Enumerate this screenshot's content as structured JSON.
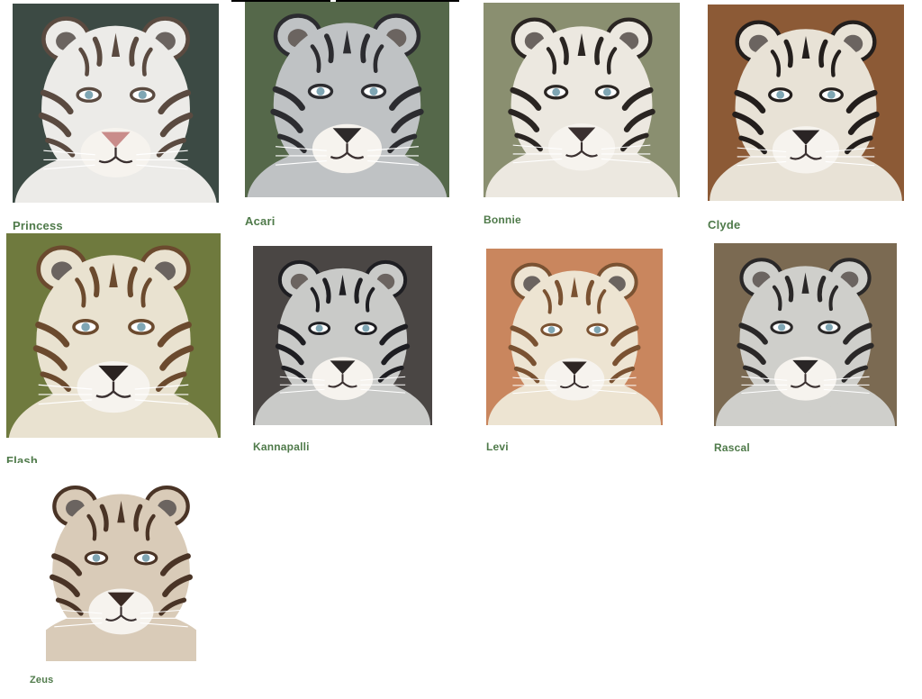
{
  "tigers": {
    "princess": {
      "name": "Princess",
      "colors": {
        "bg": "#3c4a44",
        "fur": "#ecebe8",
        "stripe": "#5a4a40",
        "nose": "#c98c8a"
      }
    },
    "acari": {
      "name": "Acari",
      "colors": {
        "bg": "#55684a",
        "fur": "#bfc2c4",
        "stripe": "#2c2c30",
        "nose": "#2d2a2a"
      }
    },
    "bonnie": {
      "name": "Bonnie",
      "colors": {
        "bg": "#8a8f70",
        "fur": "#ece8e0",
        "stripe": "#2a2522",
        "nose": "#3a3030"
      }
    },
    "clyde": {
      "name": "Clyde",
      "colors": {
        "bg": "#8c5a36",
        "fur": "#e8e2d6",
        "stripe": "#231e1c",
        "nose": "#2a2424"
      }
    },
    "flash": {
      "name": "Flash",
      "colors": {
        "bg": "#6f7a3e",
        "fur": "#e9e2d0",
        "stripe": "#6b4a2e",
        "nose": "#2a2220"
      }
    },
    "kannapalli": {
      "name": "Kannapalli",
      "colors": {
        "bg": "#4a4644",
        "fur": "#c9cac8",
        "stripe": "#1e1e22",
        "nose": "#2a2626"
      }
    },
    "levi": {
      "name": "Levi",
      "colors": {
        "bg": "#c9865e",
        "fur": "#ede4d2",
        "stripe": "#7a5232",
        "nose": "#2e2624"
      }
    },
    "rascal": {
      "name": "Rascal",
      "colors": {
        "bg": "#7b6a52",
        "fur": "#cfcfcb",
        "stripe": "#2a2828",
        "nose": "#2a2626"
      }
    },
    "zeus": {
      "name": "Zeus",
      "colors": {
        "bg": "#ffffff",
        "fur": "#d9cbb8",
        "stripe": "#4a3426",
        "nose": "#3a2a24"
      }
    }
  },
  "name_color": "#4f7a4a"
}
